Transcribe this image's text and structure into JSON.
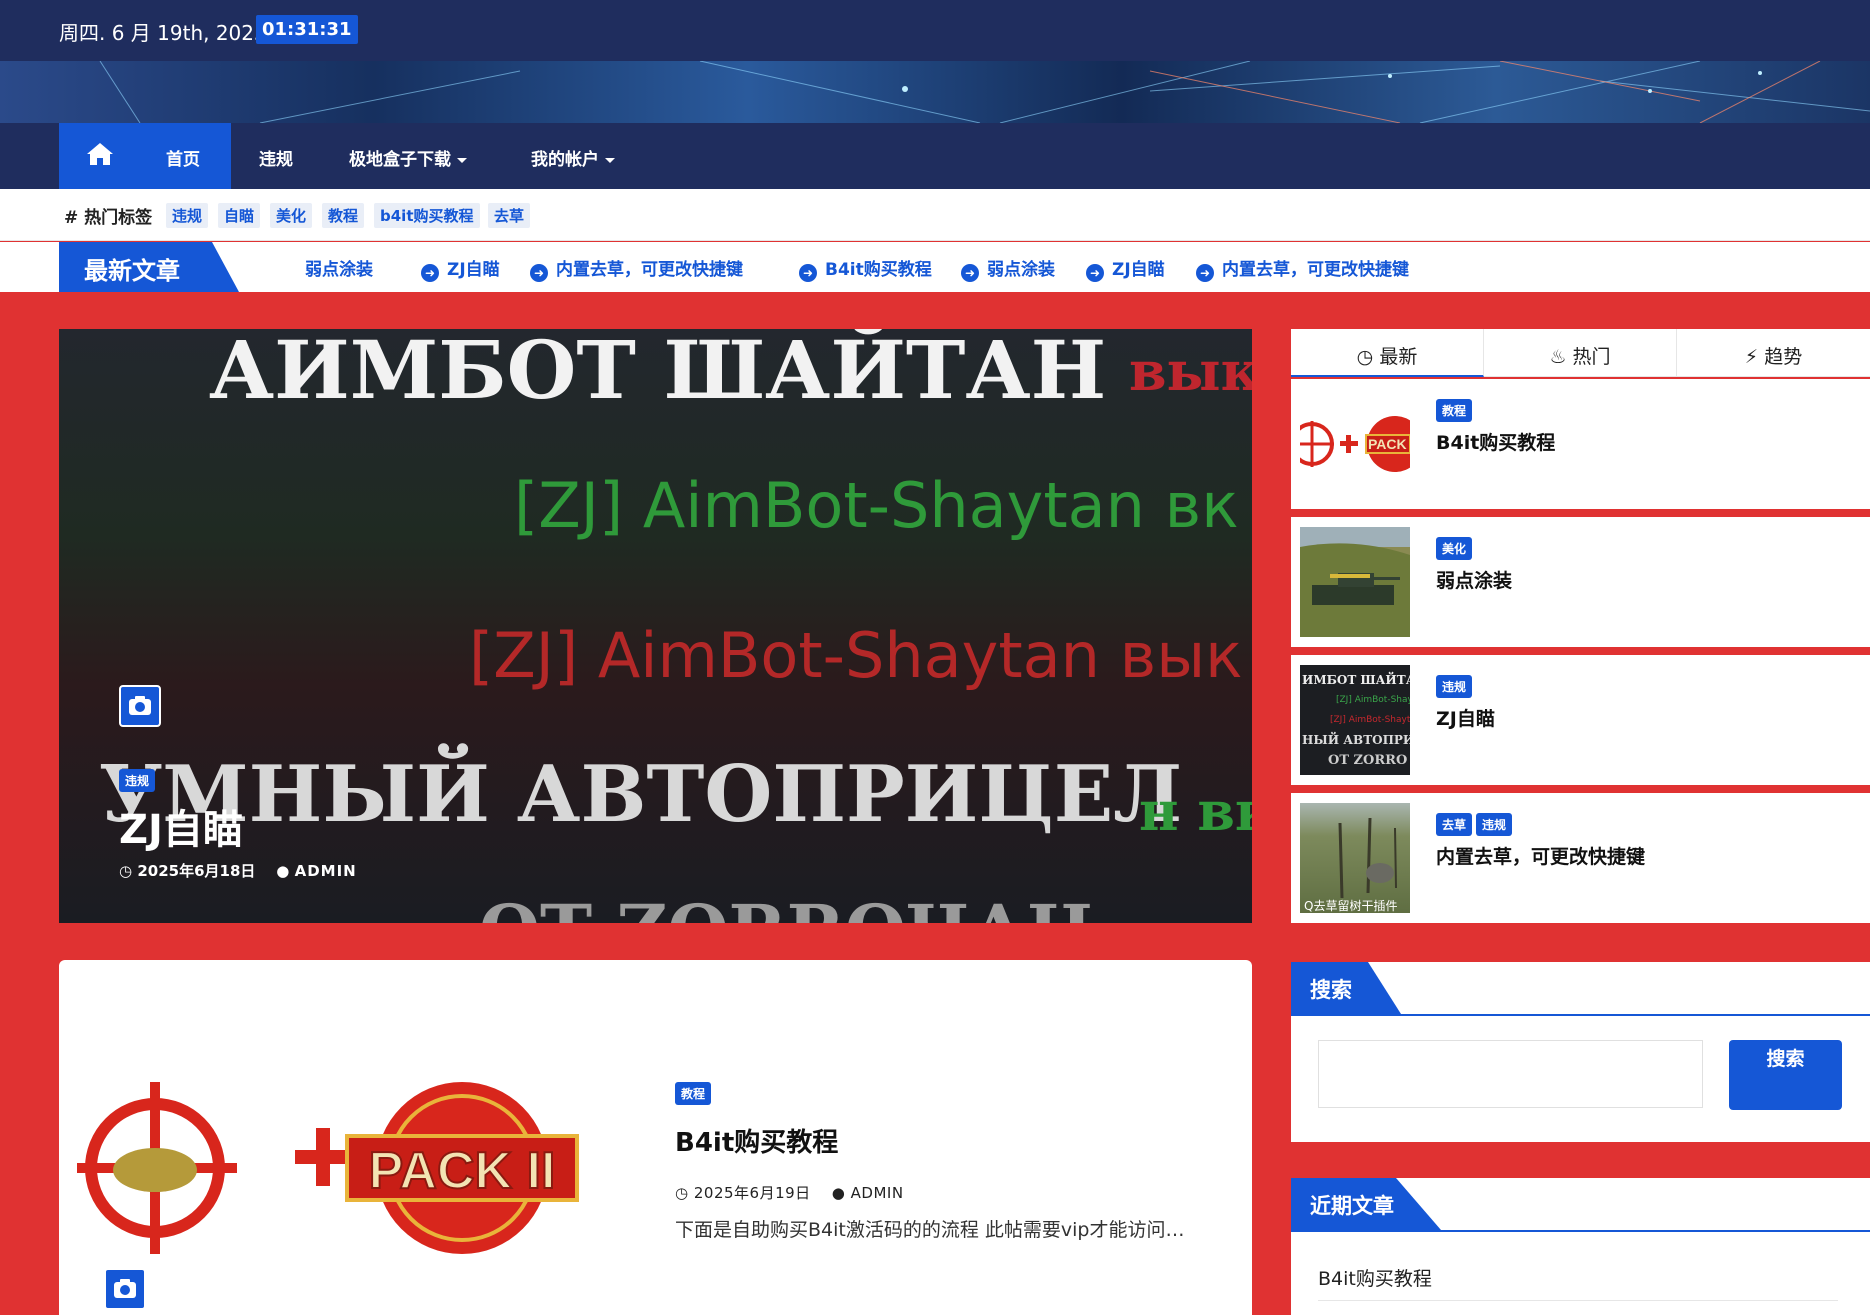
{
  "topbar": {
    "date": "周四. 6 月 19th, 2025",
    "time": "01:31:31"
  },
  "nav": {
    "home": "首页",
    "items": [
      "违规",
      "极地盒子下载",
      "我的帐户"
    ]
  },
  "hot_tags": {
    "title": "热门标签",
    "tags": [
      "违规",
      "自瞄",
      "美化",
      "教程",
      "b4it购买教程",
      "去草"
    ]
  },
  "ticker": {
    "label": "最新文章",
    "items": [
      "弱点涂装",
      "ZJ自瞄",
      "内置去草，可更改快捷键",
      "B4it购买教程",
      "弱点涂装",
      "ZJ自瞄",
      "内置去草，可更改快捷键"
    ]
  },
  "hero": {
    "overlay_lines": [
      "АИМБОТ ШАЙТАН",
      "вык",
      "[ZJ] AimBot-Shaytan вк",
      "[ZJ] AimBot-Shaytan вык",
      "УМНЫЙ АВТОПРИЦЕЛ",
      "н вк",
      "ОТ ZORROЧАН"
    ],
    "badge": "违规",
    "title": "ZJ自瞄",
    "date": "2025年6月18日",
    "author": "ADMIN"
  },
  "post": {
    "badge": "教程",
    "title": "B4it购买教程",
    "date": "2025年6月19日",
    "author": "ADMIN",
    "excerpt": "下面是自助购买B4it激活码的的流程 此帖需要vip才能访问…",
    "thumb_text": "PACK II"
  },
  "sidebar": {
    "tabs": [
      "最新",
      "热门",
      "趋势"
    ],
    "items": [
      {
        "badges": [
          "教程"
        ],
        "title": "B4it购买教程",
        "thumb_text": "PACK"
      },
      {
        "badges": [
          "美化"
        ],
        "title": "弱点涂装"
      },
      {
        "badges": [
          "违规"
        ],
        "title": "ZJ自瞄",
        "thumb_lines": [
          "ИМБОТ ШАЙТА",
          "[ZJ] AimBot-Shay",
          "[ZJ] AimBot-Shayt",
          "НЫЙ АВТОПРИЦЕ",
          "ОТ ZORRO"
        ]
      },
      {
        "badges": [
          "去草",
          "违规"
        ],
        "title": "内置去草，可更改快捷键",
        "thumb_caption": "Q去草留树干插件"
      }
    ],
    "search_title": "搜索",
    "search_button": "搜索",
    "recent_title": "近期文章",
    "recent_items": [
      "B4it购买教程"
    ]
  },
  "colors": {
    "primary": "#1557d6",
    "navy": "#1f2d5e",
    "background": "#e03232"
  }
}
